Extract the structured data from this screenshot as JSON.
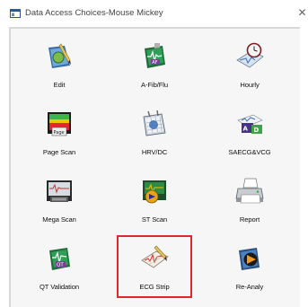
{
  "window": {
    "title": "Data Access Choices-Mouse Mickey",
    "close_glyph": "✕"
  },
  "tiles": [
    {
      "label": "Edit",
      "icon": "edit-pencil-icon"
    },
    {
      "label": "A-Fib/Flu",
      "icon": "afib-book-icon"
    },
    {
      "label": "Hourly",
      "icon": "hourly-clock-icon"
    },
    {
      "label": "Page Scan",
      "icon": "page-scan-icon"
    },
    {
      "label": "HRV/DC",
      "icon": "hrv-calendar-icon"
    },
    {
      "label": "SAECG&VCG",
      "icon": "saecg-vcg-icon"
    },
    {
      "label": "Mega Scan",
      "icon": "mega-scan-icon"
    },
    {
      "label": "ST Scan",
      "icon": "st-scan-icon"
    },
    {
      "label": "Report",
      "icon": "printer-icon"
    },
    {
      "label": "QT Validation",
      "icon": "qt-validation-icon"
    },
    {
      "label": "ECG Strip",
      "icon": "ecg-strip-icon",
      "selected": true
    },
    {
      "label": "Re-Analy",
      "icon": "reanalyze-icon"
    }
  ],
  "colors": {
    "selection_border": "#e3262b"
  }
}
